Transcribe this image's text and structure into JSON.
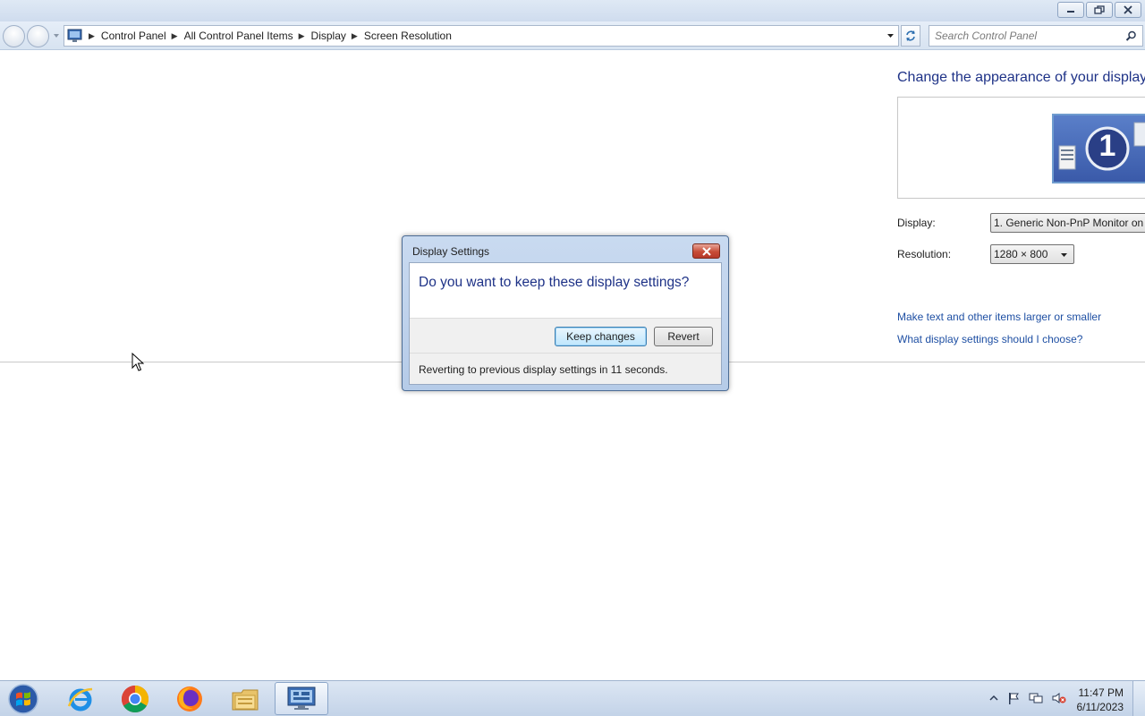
{
  "window": {
    "controls": [
      "minimize",
      "restore",
      "close"
    ]
  },
  "address_bar": {
    "breadcrumb": [
      "Control Panel",
      "All Control Panel Items",
      "Display",
      "Screen Resolution"
    ],
    "search_placeholder": "Search Control Panel"
  },
  "main": {
    "heading": "Change the appearance of your display",
    "monitor_number": "1",
    "display_label": "Display:",
    "display_value": "1. Generic Non-PnP Monitor on",
    "resolution_label": "Resolution:",
    "resolution_value": "1280 × 800",
    "links": [
      "Make text and other items larger or smaller",
      "What display settings should I choose?"
    ]
  },
  "dialog": {
    "title": "Display Settings",
    "question": "Do you want to keep these display settings?",
    "keep_label": "Keep changes",
    "revert_label": "Revert",
    "status": "Reverting to previous display settings in 11 seconds."
  },
  "taskbar": {
    "apps": [
      "internet-explorer-icon",
      "chrome-icon",
      "firefox-icon",
      "file-explorer-icon",
      "control-panel-icon"
    ],
    "active_app": "control-panel-icon",
    "tray_icons": [
      "show-hidden-icons-chevron",
      "action-center-flag-icon",
      "network-icon",
      "volume-muted-icon"
    ],
    "time": "11:47 PM",
    "date": "6/11/2023"
  },
  "colors": {
    "heading_blue": "#1e3287",
    "link_blue": "#1e4fa3",
    "dialog_frame": "#b5cbe8",
    "close_red": "#c74c37",
    "taskbar": "#c3d3e8"
  }
}
